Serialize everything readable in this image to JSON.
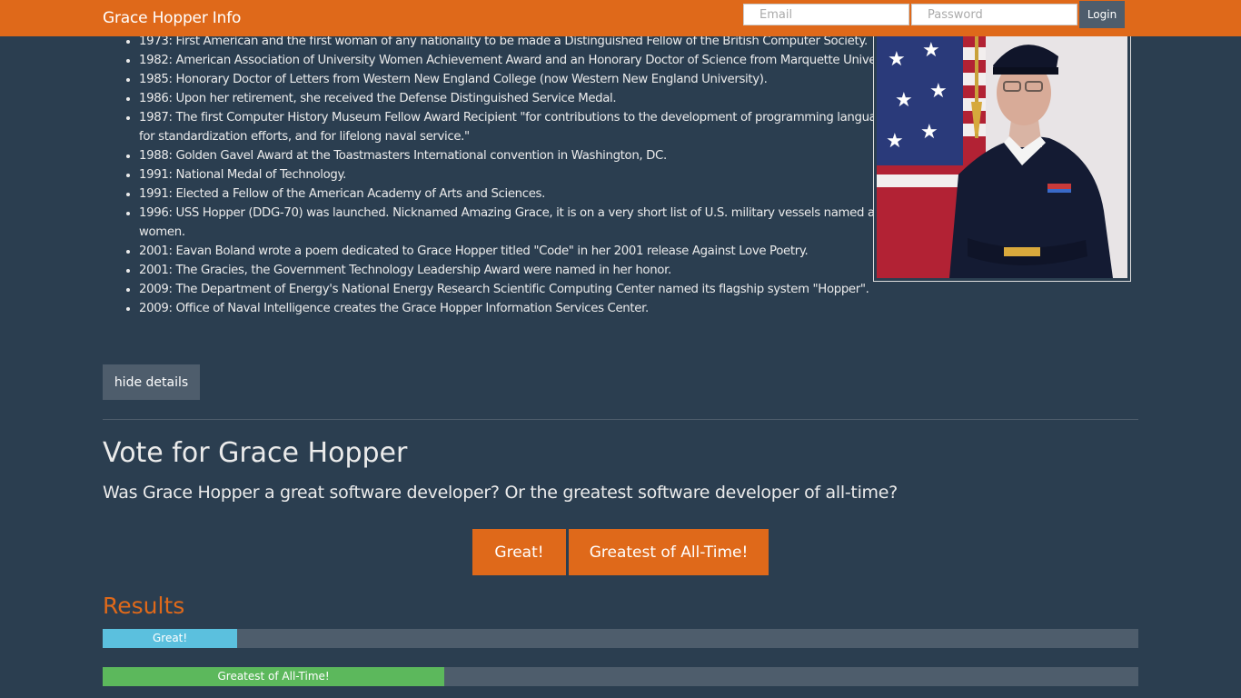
{
  "navbar": {
    "brand": "Grace Hopper Info",
    "email_placeholder": "Email",
    "password_placeholder": "Password",
    "login_label": "Login"
  },
  "awards": [
    "1973: First American and the first woman of any nationality to be made a Distinguished Fellow of the British Computer Society.",
    "1982: American Association of University Women Achievement Award and an Honorary Doctor of Science from Marquette University.",
    "1985: Honorary Doctor of Letters from Western New England College (now Western New England University).",
    "1986: Upon her retirement, she received the Defense Distinguished Service Medal.",
    "1987: The first Computer History Museum Fellow Award Recipient \"for contributions to the development of programming languages, for standardization efforts, and for lifelong naval service.\"",
    "1988: Golden Gavel Award at the Toastmasters International convention in Washington, DC.",
    "1991: National Medal of Technology.",
    "1991: Elected a Fellow of the American Academy of Arts and Sciences.",
    "1996: USS Hopper (DDG-70) was launched. Nicknamed Amazing Grace, it is on a very short list of U.S. military vessels named after women.",
    "2001: Eavan Boland wrote a poem dedicated to Grace Hopper titled \"Code\" in her 2001 release Against Love Poetry.",
    "2001: The Gracies, the Government Technology Leadership Award were named in her honor.",
    "2009: The Department of Energy's National Energy Research Scientific Computing Center named its flagship system \"Hopper\".",
    "2009: Office of Naval Intelligence creates the Grace Hopper Information Services Center."
  ],
  "details": {
    "hide_label": "hide details"
  },
  "vote": {
    "heading": "Vote for Grace Hopper",
    "question": "Was Grace Hopper a great software developer? Or the greatest software developer of all-time?",
    "great_label": "Great!",
    "greatest_label": "Greatest of All-Time!"
  },
  "results": {
    "heading": "Results",
    "bars": [
      {
        "label": "Great!",
        "percent": 13,
        "color": "#5bc0de"
      },
      {
        "label": "Greatest of All-Time!",
        "percent": 33,
        "color": "#5cb85c"
      }
    ]
  }
}
